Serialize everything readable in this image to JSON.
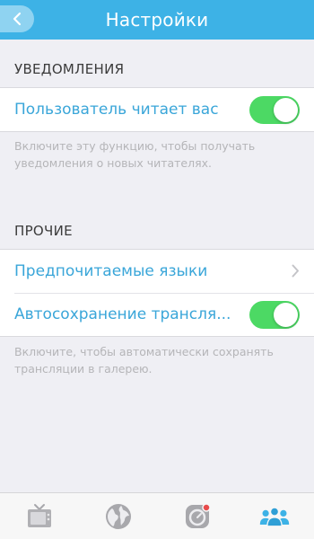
{
  "navbar": {
    "title": "Настройки",
    "back_icon": "chevron-left-icon"
  },
  "sections": {
    "notifications": {
      "header": "УВЕДОМЛЕНИЯ",
      "row_label": "Пользователь читает вас",
      "toggle_on": true,
      "footnote": "Включите эту функцию, чтобы получать уведомления о новых читателях."
    },
    "other": {
      "header": "ПРОЧИЕ",
      "languages_label": "Предпочитаемые языки",
      "autosave_label": "Автосохранение трансля...",
      "autosave_toggle_on": true,
      "footnote": "Включите, чтобы автоматически сохранять трансляции в галерею."
    }
  },
  "tabbar": {
    "tabs": [
      "tv-icon",
      "globe-icon",
      "camera-record-icon",
      "people-icon"
    ],
    "active_tab": "people-icon"
  },
  "colors": {
    "accent": "#3db2e6",
    "toggle_on": "#4cd964",
    "label": "#3aa6d9",
    "background": "#efeff4"
  }
}
